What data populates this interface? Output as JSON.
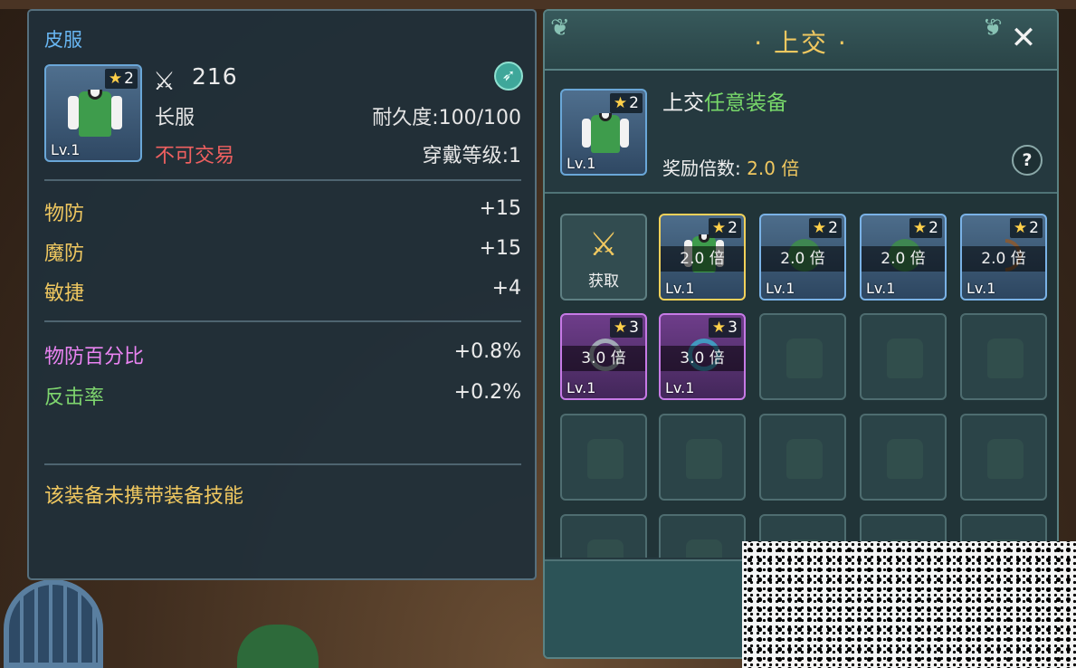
{
  "item_detail": {
    "title": "皮服",
    "star": "2",
    "level": "Lv.1",
    "attack": "216",
    "type": "长服",
    "durability": "耐久度:100/100",
    "trade_status": "不可交易",
    "wear_level": "穿戴等级:1",
    "base_stats": [
      {
        "name": "物防",
        "value": "+15"
      },
      {
        "name": "魔防",
        "value": "+15"
      },
      {
        "name": "敏捷",
        "value": "+4"
      }
    ],
    "extra_stats": [
      {
        "name": "物防百分比",
        "value": "+0.8%"
      },
      {
        "name": "反击率",
        "value": "+0.2%"
      }
    ],
    "skill_note": "该装备未携带装备技能"
  },
  "submit_panel": {
    "title": "· 上交 ·",
    "requirement_prefix": "上交",
    "requirement_highlight": "任意装备",
    "required_star": "2",
    "required_level": "Lv.1",
    "reward_label": "奖励倍数: ",
    "reward_value": "2.0 倍",
    "help_label": "?",
    "close_label": "✕",
    "acquire_label": "获取",
    "slots": [
      {
        "star": "2",
        "level": "Lv.1",
        "multiplier": "2.0 倍",
        "rarity": "blue",
        "icon": "shirt",
        "selected": true
      },
      {
        "star": "2",
        "level": "Lv.1",
        "multiplier": "2.0 倍",
        "rarity": "blue",
        "icon": "green-gem",
        "selected": false
      },
      {
        "star": "2",
        "level": "Lv.1",
        "multiplier": "2.0 倍",
        "rarity": "blue",
        "icon": "green-gem",
        "selected": false
      },
      {
        "star": "2",
        "level": "Lv.1",
        "multiplier": "2.0 倍",
        "rarity": "blue",
        "icon": "bow",
        "selected": false
      },
      {
        "star": "3",
        "level": "Lv.1",
        "multiplier": "3.0 倍",
        "rarity": "purple",
        "icon": "ring",
        "selected": false
      },
      {
        "star": "3",
        "level": "Lv.1",
        "multiplier": "3.0 倍",
        "rarity": "purple",
        "icon": "ring2",
        "selected": false
      }
    ]
  }
}
